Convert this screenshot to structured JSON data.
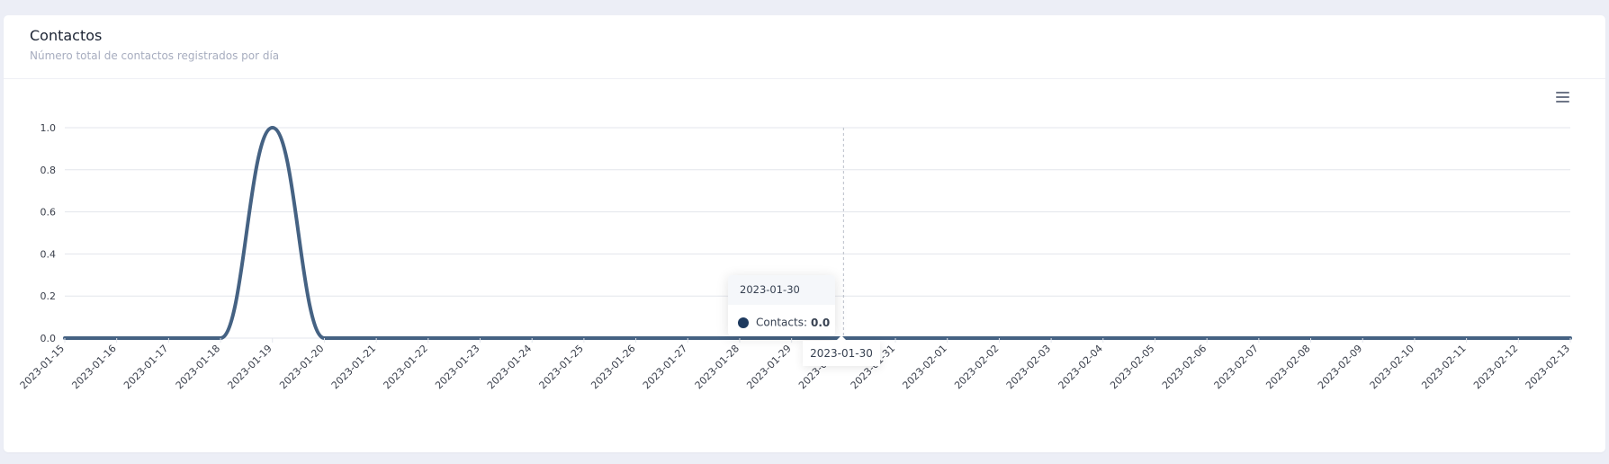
{
  "card": {
    "title": "Contactos",
    "subtitle": "Número total de contactos registrados por día"
  },
  "toolbar": {
    "menu_icon": "hamburger-menu-icon"
  },
  "tooltip": {
    "date": "2023-01-30",
    "series_label": "Contacts:",
    "value": "0.0",
    "x_label": "2023-01-30"
  },
  "colors": {
    "line": "#456283",
    "marker": "#1e3a5f",
    "grid": "#e3e6ec",
    "axis_text": "#3a3f4b"
  },
  "chart_data": {
    "type": "line",
    "title": "",
    "xlabel": "",
    "ylabel": "",
    "ylim": [
      0,
      1
    ],
    "yticks": [
      "0.0",
      "0.2",
      "0.4",
      "0.6",
      "0.8",
      "1.0"
    ],
    "grid": true,
    "categories": [
      "2023-01-15",
      "2023-01-16",
      "2023-01-17",
      "2023-01-18",
      "2023-01-19",
      "2023-01-20",
      "2023-01-21",
      "2023-01-22",
      "2023-01-23",
      "2023-01-24",
      "2023-01-25",
      "2023-01-26",
      "2023-01-27",
      "2023-01-28",
      "2023-01-29",
      "2023-01-30",
      "2023-01-31",
      "2023-02-01",
      "2023-02-02",
      "2023-02-03",
      "2023-02-04",
      "2023-02-05",
      "2023-02-06",
      "2023-02-07",
      "2023-02-08",
      "2023-02-09",
      "2023-02-10",
      "2023-02-11",
      "2023-02-12",
      "2023-02-13"
    ],
    "series": [
      {
        "name": "Contacts",
        "values": [
          0,
          0,
          0,
          0,
          1,
          0,
          0,
          0,
          0,
          0,
          0,
          0,
          0,
          0,
          0,
          0,
          0,
          0,
          0,
          0,
          0,
          0,
          0,
          0,
          0,
          0,
          0,
          0,
          0,
          0
        ]
      }
    ],
    "hover_index": 15
  }
}
